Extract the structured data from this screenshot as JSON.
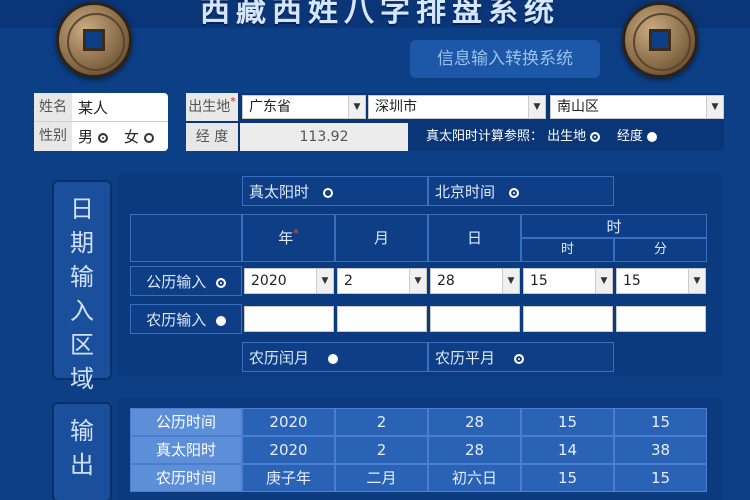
{
  "app": {
    "title": "西藏西姓八字排盘系统",
    "subtitle": "信息输入转换系统"
  },
  "person": {
    "name_label": "姓名",
    "name_value": "某人",
    "gender_label": "性别",
    "male_label": "男",
    "female_label": "女",
    "selected_gender": "男"
  },
  "birthplace": {
    "label": "出生地",
    "required_mark": "*",
    "province": "广东省",
    "city": "深圳市",
    "district": "南山区",
    "longitude_label": "经  度",
    "longitude_value": "113.92",
    "solar_ref_label": "真太阳时计算参照：",
    "ref_birthplace_label": "出生地",
    "ref_longitude_label": "经度",
    "selected_ref": "出生地"
  },
  "date_input": {
    "side_label": [
      "日",
      "期",
      "输",
      "入",
      "区",
      "域"
    ],
    "time_mode": {
      "solar_label": "真太阳时",
      "beijing_label": "北京时间",
      "selected": "北京时间"
    },
    "headers": {
      "year": "年",
      "year_required": "*",
      "month": "月",
      "day": "日",
      "time": "时",
      "hour": "时",
      "minute": "分"
    },
    "gregorian": {
      "label": "公历输入",
      "year": "2020",
      "month": "2",
      "day": "28",
      "hour": "15",
      "minute": "15",
      "selected": true
    },
    "lunar": {
      "label": "农历输入",
      "selected": false
    },
    "lunar_month_type": {
      "leap_label": "农历闰月",
      "normal_label": "农历平月",
      "selected": "农历平月"
    }
  },
  "output": {
    "side_label": [
      "输",
      "出"
    ],
    "rows": [
      {
        "label": "公历时间",
        "values": [
          "2020",
          "2",
          "28",
          "15",
          "15"
        ]
      },
      {
        "label": "真太阳时",
        "values": [
          "2020",
          "2",
          "28",
          "14",
          "38"
        ]
      },
      {
        "label": "农历时间",
        "values": [
          "庚子年",
          "二月",
          "初六日",
          "15",
          "15"
        ]
      }
    ]
  }
}
